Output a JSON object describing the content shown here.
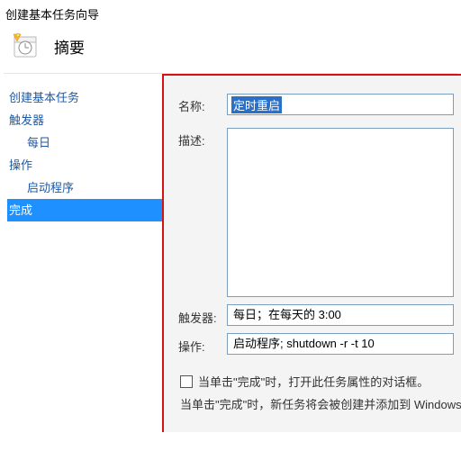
{
  "window_title": "创建基本任务向导",
  "summary_label": "摘要",
  "sidebar": {
    "items": [
      {
        "label": "创建基本任务",
        "indent": false,
        "selected": false
      },
      {
        "label": "触发器",
        "indent": false,
        "selected": false
      },
      {
        "label": "每日",
        "indent": true,
        "selected": false
      },
      {
        "label": "操作",
        "indent": false,
        "selected": false
      },
      {
        "label": "启动程序",
        "indent": true,
        "selected": false
      },
      {
        "label": "完成",
        "indent": false,
        "selected": true
      }
    ]
  },
  "form": {
    "name_label": "名称:",
    "name_value": "定时重启",
    "desc_label": "描述:",
    "trigger_label": "触发器:",
    "trigger_value": "每日；在每天的 3:00",
    "action_label": "操作:",
    "action_value": "启动程序; shutdown -r -t 10",
    "checkbox_text": "当单击\"完成\"时，打开此任务属性的对话框。",
    "final_text": "当单击\"完成\"时，新任务将会被创建并添加到 Windows 计"
  }
}
